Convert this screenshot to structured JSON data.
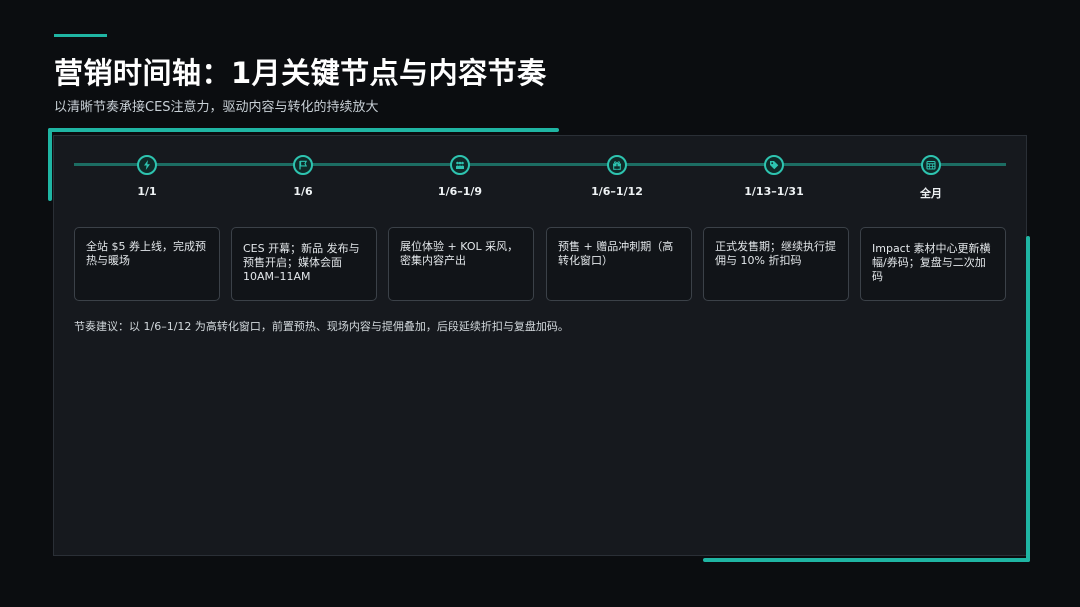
{
  "header": {
    "title": "营销时间轴：1月关键节点与内容节奏",
    "subtitle": "以清晰节奏承接CES注意力，驱动内容与转化的持续放大"
  },
  "colors": {
    "accent": "#1fb5a3",
    "background": "#0b0d10",
    "panel": "#16191e"
  },
  "timeline": {
    "milestones": [
      {
        "date": "1/1",
        "icon": "lightning-icon",
        "text": "全站 $5 券上线，完成预热与暖场"
      },
      {
        "date": "1/6",
        "icon": "flag-icon",
        "text": "CES 开幕；新品 发布与预售开启；媒体会面 10AM–11AM"
      },
      {
        "date": "1/6–1/9",
        "icon": "people-icon",
        "text": "展位体验 + KOL 采风，密集内容产出"
      },
      {
        "date": "1/6–1/12",
        "icon": "gift-icon",
        "text": "预售 + 赠品冲刺期（高转化窗口）"
      },
      {
        "date": "1/13–1/31",
        "icon": "tag-icon",
        "text": "正式发售期；继续执行提佣与 10% 折扣码"
      },
      {
        "date": "全月",
        "icon": "calendar-icon",
        "text": "Impact 素材中心更新横幅/券码；复盘与二次加码"
      }
    ]
  },
  "note": "节奏建议：以 1/6–1/12 为高转化窗口，前置预热、现场内容与提佣叠加，后段延续折扣与复盘加码。"
}
